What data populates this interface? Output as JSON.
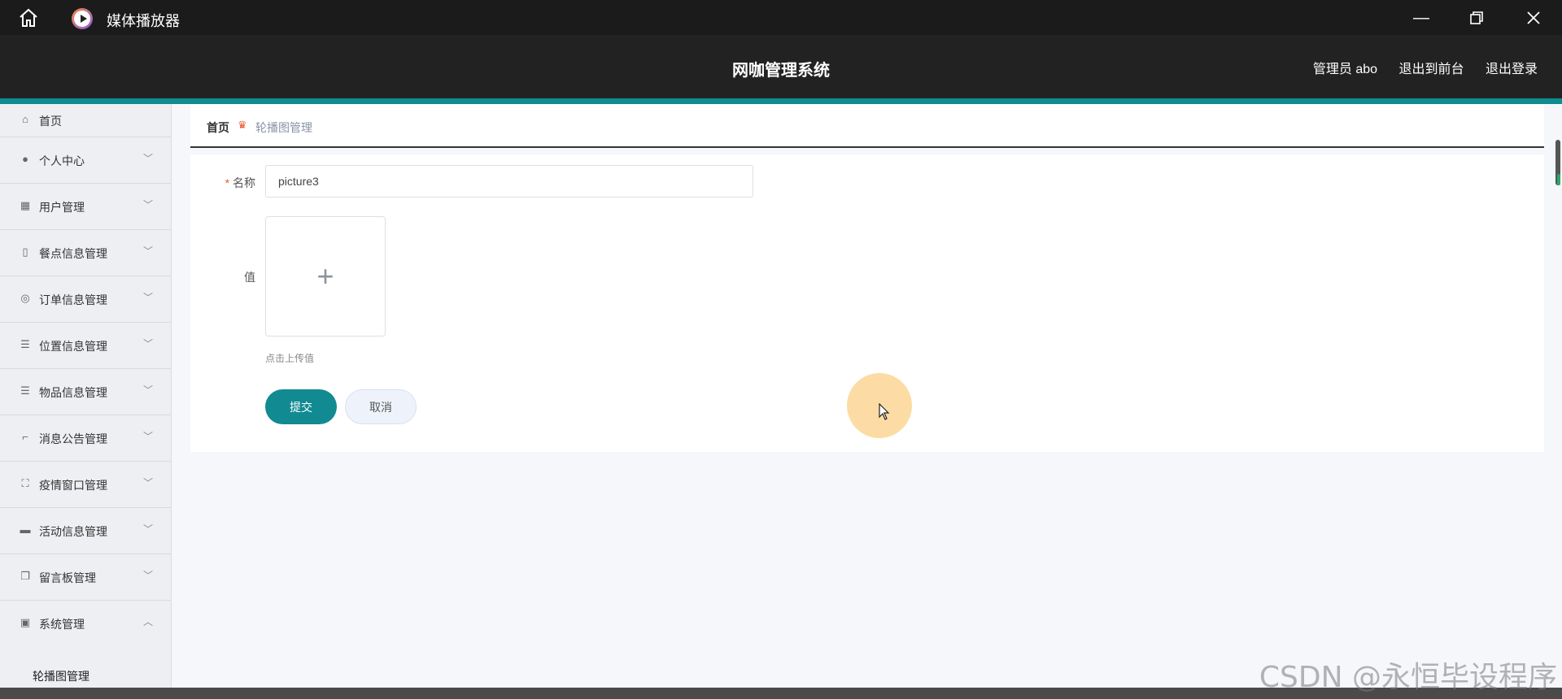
{
  "titlebar": {
    "app_title": "媒体播放器",
    "icons": {
      "home": "home-icon",
      "app": "play-circle-icon",
      "minimize": "minimize-icon",
      "restore": "restore-icon",
      "close": "close-icon"
    }
  },
  "header": {
    "title": "网咖管理系统",
    "user": "管理员 abo",
    "to_front": "退出到前台",
    "logout": "退出登录",
    "accent_color": "#0e8c8f"
  },
  "sidebar": {
    "items": [
      {
        "label": "首页",
        "icon": "home-icon"
      },
      {
        "label": "个人中心",
        "icon": "user-icon"
      },
      {
        "label": "用户管理",
        "icon": "grid-icon"
      },
      {
        "label": "餐点信息管理",
        "icon": "phone-icon"
      },
      {
        "label": "订单信息管理",
        "icon": "gauge-icon"
      },
      {
        "label": "位置信息管理",
        "icon": "list-icon"
      },
      {
        "label": "物品信息管理",
        "icon": "list-icon"
      },
      {
        "label": "消息公告管理",
        "icon": "crop-icon"
      },
      {
        "label": "疫情窗口管理",
        "icon": "fullscreen-icon"
      },
      {
        "label": "活动信息管理",
        "icon": "chat-icon"
      },
      {
        "label": "留言板管理",
        "icon": "copy-icon"
      },
      {
        "label": "系统管理",
        "icon": "trash-icon"
      }
    ],
    "sub_item": "轮播图管理"
  },
  "breadcrumb": {
    "home": "首页",
    "current": "轮播图管理"
  },
  "form": {
    "name_label": "名称",
    "name_required": "*",
    "name_value": "picture3",
    "value_label": "值",
    "upload_hint": "点击上传值",
    "submit": "提交",
    "cancel": "取消",
    "primary_color": "#118a91"
  },
  "watermark": "CSDN @永恒毕设程序"
}
